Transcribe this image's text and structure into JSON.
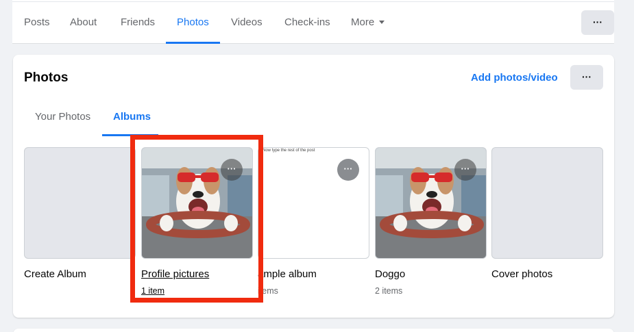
{
  "nav": {
    "tabs": [
      {
        "label": "Posts"
      },
      {
        "label": "About"
      },
      {
        "label": "Friends"
      },
      {
        "label": "Photos",
        "active": true
      },
      {
        "label": "Videos"
      },
      {
        "label": "Check-ins"
      },
      {
        "label": "More"
      }
    ],
    "more_button_label": "···"
  },
  "photos_card": {
    "title": "Photos",
    "add_link": "Add photos/video",
    "more_button_label": "···",
    "subtabs": [
      {
        "label": "Your Photos"
      },
      {
        "label": "Albums",
        "active": true
      }
    ],
    "albums": [
      {
        "name": "Create Album",
        "count": ""
      },
      {
        "name": "Profile pictures",
        "count": "1 item",
        "highlighted": true
      },
      {
        "name": "ample album",
        "count": "items",
        "thumb_caption": "Now type the rest of the post"
      },
      {
        "name": "Doggo",
        "count": "2 items"
      },
      {
        "name": "Cover photos",
        "count": ""
      }
    ],
    "tile_more_label": "···"
  },
  "colors": {
    "accent": "#1877f2",
    "highlight": "#f02b0f",
    "background": "#f0f2f5"
  }
}
